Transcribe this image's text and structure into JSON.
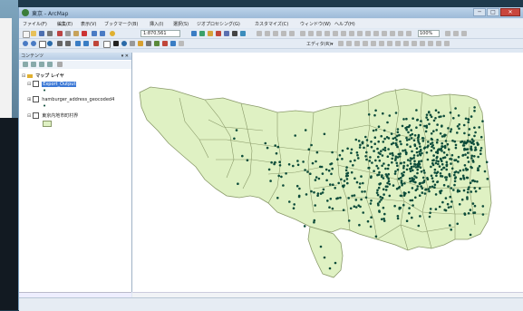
{
  "window": {
    "title": "東京 - ArcMap",
    "min_glyph": "─",
    "max_glyph": "□",
    "close_glyph": "✕"
  },
  "menu": [
    "ファイル(F)",
    "編集(E)",
    "表示(V)",
    "ブックマーク(B)",
    "挿入(I)",
    "選択(S)",
    "ジオプロセシング(G)",
    "カスタマイズ(C)",
    "ウィンドウ(W)",
    "ヘルプ(H)"
  ],
  "toolbar": {
    "scale": "1:870,561",
    "editor": "エディタ(R)▾",
    "zoom": "100%"
  },
  "toc": {
    "title": "コンテンツ",
    "pin_glyph": "▾ ✕",
    "group": "マップ レイヤ",
    "layers": [
      "Export_Output",
      "hamburger_address_geocoded4",
      "東京内地市町村界"
    ]
  },
  "map": {
    "background": "#ffffff",
    "fill": "#dff1c3",
    "stroke": "#8a9a6a",
    "point_color": "#0d4c3b"
  },
  "colors": {
    "title_bar": "#a9c4e0",
    "selection": "#3b78d6"
  }
}
